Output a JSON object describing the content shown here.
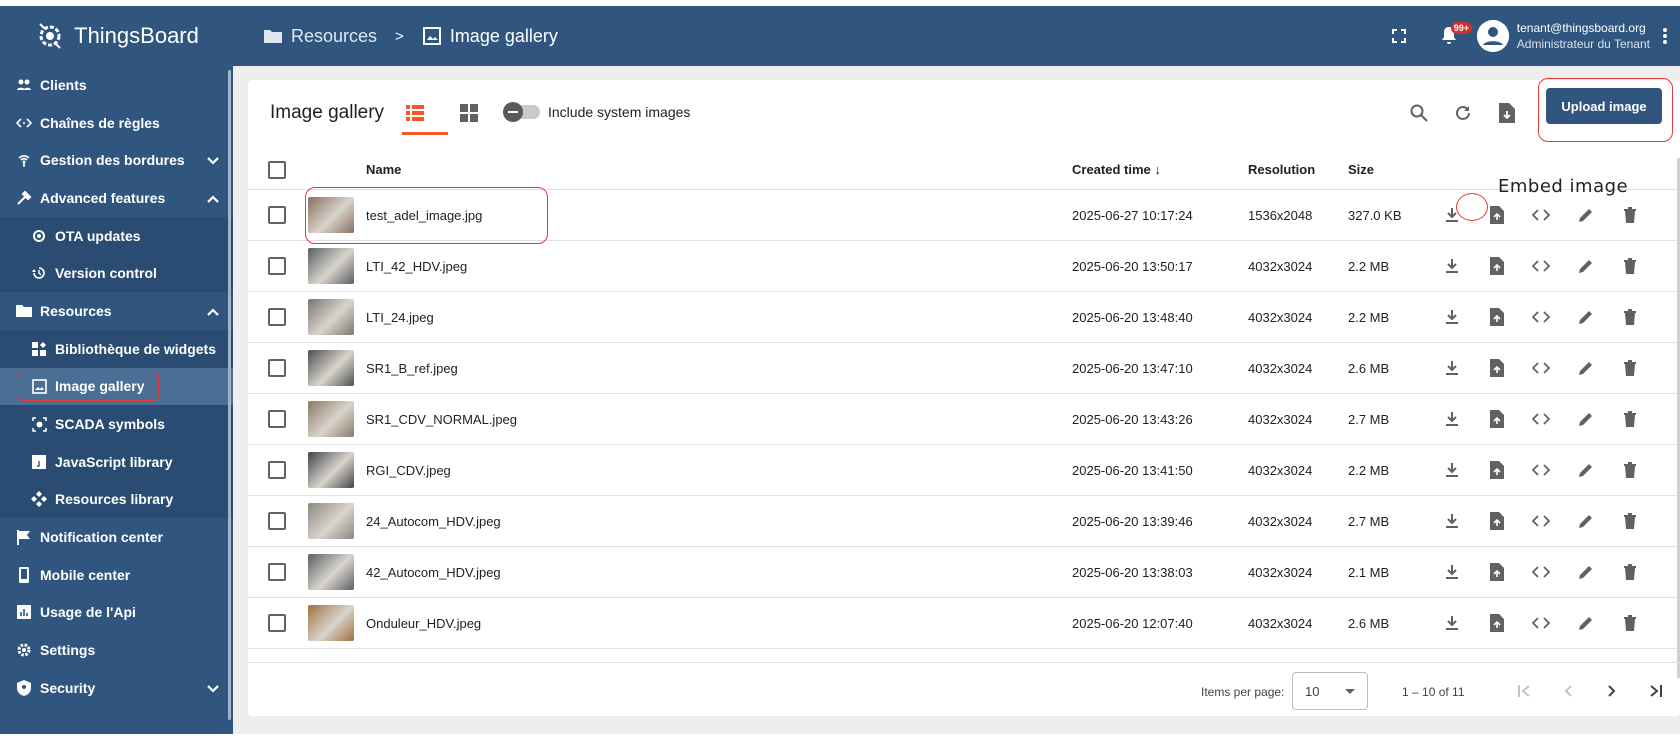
{
  "app": {
    "name": "ThingsBoard"
  },
  "breadcrumb": {
    "parent": "Resources",
    "separator": ">",
    "current": "Image gallery"
  },
  "notifications": {
    "badge": "99+"
  },
  "user": {
    "email": "tenant@thingsboard.org",
    "role": "Administrateur du Tenant"
  },
  "sidebar": {
    "items": [
      {
        "label": "Clients",
        "icon": "people-icon"
      },
      {
        "label": "Chaînes de règles",
        "icon": "code-arrows-icon"
      },
      {
        "label": "Gestion des bordures",
        "icon": "router-icon",
        "chevron": "down"
      },
      {
        "label": "Advanced features",
        "icon": "tools-icon",
        "chevron": "up"
      },
      {
        "label": "OTA updates",
        "icon": "ota-icon",
        "sub": true
      },
      {
        "label": "Version control",
        "icon": "history-icon",
        "sub": true
      },
      {
        "label": "Resources",
        "icon": "folder-icon",
        "chevron": "up"
      },
      {
        "label": "Bibliothèque de widgets",
        "icon": "widgets-icon",
        "sub": true
      },
      {
        "label": "Image gallery",
        "icon": "image-icon",
        "sub": true,
        "active": true
      },
      {
        "label": "SCADA symbols",
        "icon": "scada-icon",
        "sub": true
      },
      {
        "label": "JavaScript library",
        "icon": "js-icon",
        "sub": true
      },
      {
        "label": "Resources library",
        "icon": "library-icon",
        "sub": true
      },
      {
        "label": "Notification center",
        "icon": "flag-icon"
      },
      {
        "label": "Mobile center",
        "icon": "phone-icon"
      },
      {
        "label": "Usage de l'Api",
        "icon": "chart-icon"
      },
      {
        "label": "Settings",
        "icon": "gear-icon"
      },
      {
        "label": "Security",
        "icon": "shield-icon",
        "chevron": "down"
      }
    ]
  },
  "page": {
    "title": "Image gallery",
    "toggle_label": "Include system images",
    "upload_label": "Upload image",
    "annotation": "Embed image"
  },
  "table": {
    "columns": {
      "name": "Name",
      "created": "Created time ↓",
      "resolution": "Resolution",
      "size": "Size"
    },
    "rows": [
      {
        "name": "test_adel_image.jpg",
        "created": "2025-06-27 10:17:24",
        "resolution": "1536x2048",
        "size": "327.0 KB",
        "thumb": "#8a6f5c"
      },
      {
        "name": "LTI_42_HDV.jpeg",
        "created": "2025-06-20 13:50:17",
        "resolution": "4032x3024",
        "size": "2.2 MB",
        "thumb": "#55605f"
      },
      {
        "name": "LTI_24.jpeg",
        "created": "2025-06-20 13:48:40",
        "resolution": "4032x3024",
        "size": "2.2 MB",
        "thumb": "#7a7670"
      },
      {
        "name": "SR1_B_ref.jpeg",
        "created": "2025-06-20 13:47:10",
        "resolution": "4032x3024",
        "size": "2.6 MB",
        "thumb": "#4b4e52"
      },
      {
        "name": "SR1_CDV_NORMAL.jpeg",
        "created": "2025-06-20 13:43:26",
        "resolution": "4032x3024",
        "size": "2.7 MB",
        "thumb": "#8a7a66"
      },
      {
        "name": "RGI_CDV.jpeg",
        "created": "2025-06-20 13:41:50",
        "resolution": "4032x3024",
        "size": "2.2 MB",
        "thumb": "#3e4347"
      },
      {
        "name": "24_Autocom_HDV.jpeg",
        "created": "2025-06-20 13:39:46",
        "resolution": "4032x3024",
        "size": "2.7 MB",
        "thumb": "#8c8780"
      },
      {
        "name": "42_Autocom_HDV.jpeg",
        "created": "2025-06-20 13:38:03",
        "resolution": "4032x3024",
        "size": "2.1 MB",
        "thumb": "#59606a"
      },
      {
        "name": "Onduleur_HDV.jpeg",
        "created": "2025-06-20 12:07:40",
        "resolution": "4032x3024",
        "size": "2.6 MB",
        "thumb": "#a0703f"
      }
    ]
  },
  "paginator": {
    "label": "Items per page:",
    "page_size": "10",
    "range": "1 – 10 of 11"
  },
  "colors": {
    "primary": "#305680",
    "accent": "#f15a24",
    "highlight": "#e53935"
  }
}
